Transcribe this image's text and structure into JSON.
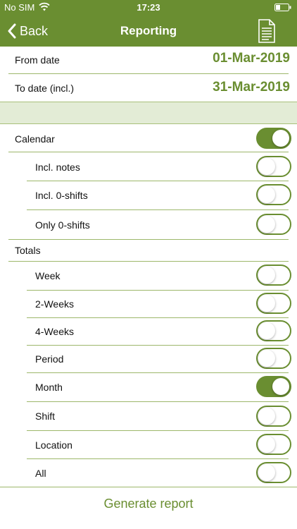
{
  "status_bar": {
    "carrier": "No SIM",
    "time": "17:23"
  },
  "nav": {
    "back_label": "Back",
    "title": "Reporting"
  },
  "dates": {
    "from_label": "From date",
    "from_value": "01-Mar-2019",
    "to_label": "To date (incl.)",
    "to_value": "31-Mar-2019"
  },
  "calendar": {
    "label": "Calendar",
    "enabled": true,
    "options": [
      {
        "label": "Incl. notes",
        "on": false
      },
      {
        "label": "Incl. 0-shifts",
        "on": false
      },
      {
        "label": "Only 0-shifts",
        "on": false
      }
    ]
  },
  "totals": {
    "label": "Totals",
    "options": [
      {
        "label": "Week",
        "on": false
      },
      {
        "label": "2-Weeks",
        "on": false
      },
      {
        "label": "4-Weeks",
        "on": false
      },
      {
        "label": "Period",
        "on": false
      },
      {
        "label": "Month",
        "on": true
      },
      {
        "label": "Shift",
        "on": false
      },
      {
        "label": "Location",
        "on": false
      },
      {
        "label": "All",
        "on": false
      }
    ]
  },
  "actions": {
    "generate_label": "Generate report"
  },
  "colors": {
    "accent": "#6a8e31",
    "band": "#e3ecd6"
  },
  "icons": {
    "back": "chevron-left-icon",
    "report": "document-icon",
    "wifi": "wifi-icon",
    "battery": "battery-icon"
  }
}
